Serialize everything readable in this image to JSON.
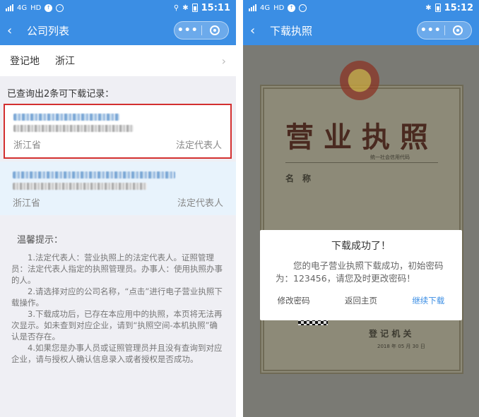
{
  "left": {
    "status": {
      "net": "4G",
      "hd": "HD",
      "time": "15:11"
    },
    "nav": {
      "back_icon": "‹",
      "title": "公司列表",
      "more": "•••"
    },
    "region": {
      "label": "登记地",
      "value": "浙江"
    },
    "result_count": "已查询出2条可下载记录：",
    "records": [
      {
        "province": "浙江省",
        "role": "法定代表人"
      },
      {
        "province": "浙江省",
        "role": "法定代表人"
      }
    ],
    "tips": {
      "title": "温馨提示：",
      "items": [
        "1.法定代表人：营业执照上的法定代表人。证照管理员：法定代表人指定的执照管理员。办事人：使用执照办事的人。",
        "2.请选择对应的公司名称，“点击”进行电子营业执照下载操作。",
        "3.下载成功后，已存在本应用中的执照，本页将无法再次显示。如未查到对应企业，请到“执照空间-本机执照”确认是否存在。",
        "4.如果您是办事人员或证照管理员并且没有查询到对应企业，请与授权人确认信息录入或者授权是否成功。"
      ]
    }
  },
  "right": {
    "status": {
      "net": "4G",
      "hd": "HD",
      "time": "15:12"
    },
    "nav": {
      "back_icon": "‹",
      "title": "下载执照",
      "more": "•••"
    },
    "certificate": {
      "title": "营业执照",
      "credit_code_label": "统一社会信用代码",
      "field_name": "名　称",
      "registrar": "登 记 机 关",
      "date": "2018 年 05 月 30 日"
    },
    "dialog": {
      "title": "下载成功了！",
      "message": "您的电子营业执照下载成功，初始密码为：123456，请您及时更改密码！",
      "btn_change": "修改密码",
      "btn_home": "返回主页",
      "btn_continue": "继续下载"
    }
  },
  "colors": {
    "accent": "#3b8ee4",
    "highlight_border": "#d32f2f"
  }
}
